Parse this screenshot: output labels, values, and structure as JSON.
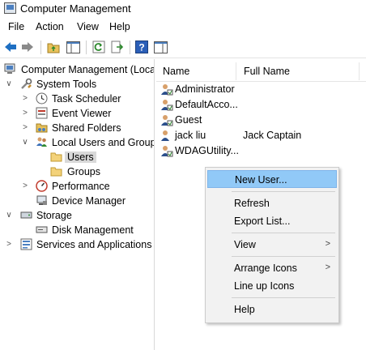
{
  "window": {
    "title": "Computer Management"
  },
  "menubar": {
    "items": [
      "File",
      "Action",
      "View",
      "Help"
    ]
  },
  "toolbar": {
    "buttons": [
      "back-arrow-icon",
      "forward-arrow-icon",
      "up-folder-icon",
      "show-hide-tree-icon",
      "refresh-icon",
      "export-list-icon",
      "help-icon",
      "show-action-pane-icon"
    ]
  },
  "tree": {
    "root": "Computer Management (Local",
    "system_tools": "System Tools",
    "task_scheduler": "Task Scheduler",
    "event_viewer": "Event Viewer",
    "shared_folders": "Shared Folders",
    "local_users_groups": "Local Users and Groups",
    "users": "Users",
    "groups": "Groups",
    "performance": "Performance",
    "device_manager": "Device Manager",
    "storage": "Storage",
    "disk_management": "Disk Management",
    "services_apps": "Services and Applications"
  },
  "list": {
    "columns": {
      "name": "Name",
      "full_name": "Full Name"
    },
    "rows": [
      {
        "name": "Administrator",
        "full_name": ""
      },
      {
        "name": "DefaultAcco...",
        "full_name": ""
      },
      {
        "name": "Guest",
        "full_name": ""
      },
      {
        "name": "jack liu",
        "full_name": "Jack Captain"
      },
      {
        "name": "WDAGUtility...",
        "full_name": ""
      }
    ]
  },
  "context_menu": {
    "new_user": "New User...",
    "refresh": "Refresh",
    "export_list": "Export List...",
    "view": "View",
    "arrange_icons": "Arrange Icons",
    "line_up_icons": "Line up Icons",
    "help": "Help"
  },
  "colors": {
    "selection": "#91c9f7",
    "tree_selected": "#d9d9d9",
    "accent": "#1e6fc2"
  }
}
